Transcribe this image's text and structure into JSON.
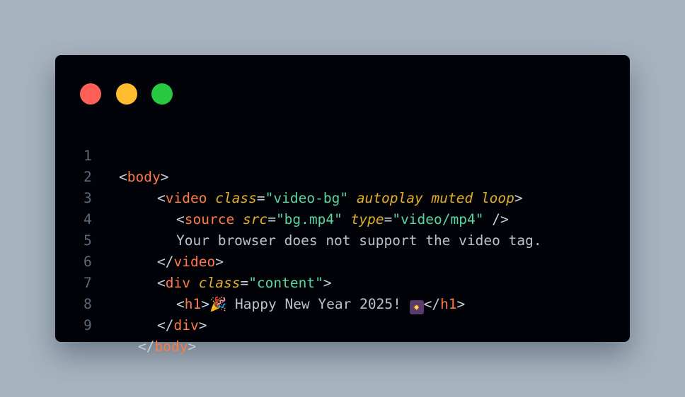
{
  "window_controls": [
    "close",
    "minimize",
    "zoom"
  ],
  "line_numbers": [
    "1",
    "2",
    "3",
    "4",
    "5",
    "6",
    "7",
    "8",
    "9"
  ],
  "code": {
    "l1": {
      "open": "<",
      "tag": "body",
      "close": ">"
    },
    "l2": {
      "open": "<",
      "tag": "video",
      "attr1": "class",
      "eq": "=",
      "val1": "\"video-bg\"",
      "attr2": "autoplay",
      "attr3": "muted",
      "attr4": "loop",
      "close": ">"
    },
    "l3": {
      "open": "<",
      "tag": "source",
      "attr1": "src",
      "eq": "=",
      "val1": "\"bg.mp4\"",
      "attr2": "type",
      "val2": "\"video/mp4\"",
      "close": "/>"
    },
    "l4": {
      "text": "Your browser does not support the video tag."
    },
    "l5": {
      "open": "</",
      "tag": "video",
      "close": ">"
    },
    "l6": {
      "open": "<",
      "tag": "div",
      "attr1": "class",
      "eq": "=",
      "val1": "\"content\"",
      "close": ">"
    },
    "l7": {
      "open": "<",
      "tag": "h1",
      "close": ">",
      "emoji1": "🎉",
      "text": "Happy New Year 2025!",
      "emoji2": "✸",
      "open2": "</",
      "tag2": "h1",
      "close2": ">"
    },
    "l8": {
      "open": "</",
      "tag": "div",
      "close": ">"
    },
    "l9": {
      "open": "</",
      "tag": "body",
      "close": ">"
    }
  },
  "colors": {
    "background": "#a7b3bf",
    "window": "#020308",
    "tag": "#ff7a45",
    "attribute": "#e0ad2a",
    "string": "#58d6a0",
    "text": "#b9c2cc",
    "line_number": "#5d6878"
  }
}
